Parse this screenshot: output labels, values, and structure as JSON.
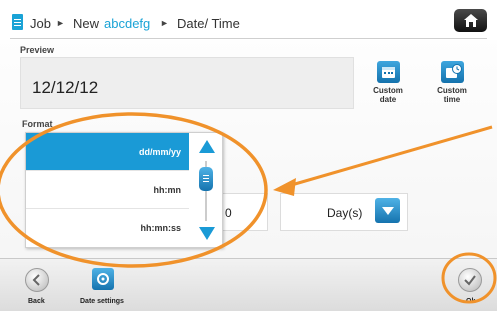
{
  "header": {
    "breadcrumb": [
      "Job",
      "New",
      "abcdefg",
      "Date/ Time"
    ],
    "separator": "►",
    "accent": "#1aa3d6",
    "home_icon": "home-icon"
  },
  "preview": {
    "label": "Preview",
    "value": "12/12/12"
  },
  "tools": {
    "custom_date": "Custom date",
    "custom_time": "Custom time"
  },
  "format": {
    "label": "Format",
    "options": [
      "dd/mm/yy",
      "hh:mn",
      "hh:mn:ss"
    ],
    "selected_index": 0
  },
  "offset": {
    "unit_value": "Day(s)",
    "number_partial": "0"
  },
  "footer": {
    "back_label": "Back",
    "date_settings_label": "Date settings",
    "ok_label": "Ok"
  },
  "colors": {
    "selected": "#1a9ad6",
    "highlight_annotation": "#f0922b"
  }
}
